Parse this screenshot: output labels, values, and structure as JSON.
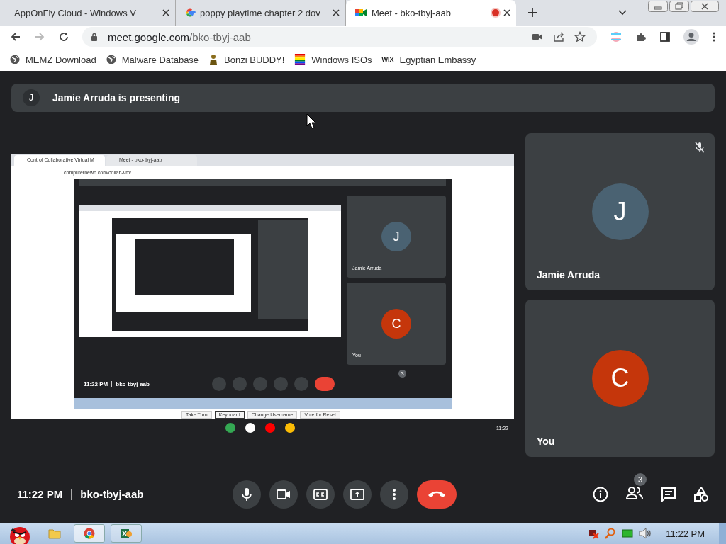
{
  "browser": {
    "tabs": [
      {
        "title": "AppOnFly Cloud - Windows V",
        "selected": false,
        "kind": "plain",
        "recording": false
      },
      {
        "title": "poppy playtime chapter 2 dov",
        "selected": false,
        "kind": "google",
        "recording": false
      },
      {
        "title": "Meet - bko-tbyj-aab",
        "selected": true,
        "kind": "meet",
        "recording": true
      }
    ],
    "url_host": "meet.google.com",
    "url_path": "/bko-tbyj-aab",
    "bookmarks": [
      {
        "label": "MEMZ Download",
        "kind": "globe"
      },
      {
        "label": "Malware Database",
        "kind": "globe"
      },
      {
        "label": "Bonzi BUDDY!",
        "kind": "figure"
      },
      {
        "label": "Windows ISOs",
        "kind": "rainbow"
      },
      {
        "label": "Egyptian Embassy",
        "kind": "wix",
        "logo": "WIX"
      }
    ]
  },
  "presenting": {
    "initial": "J",
    "text": "Jamie Arruda is presenting"
  },
  "shared_screen": {
    "tabs": [
      {
        "title": "Control Collaborative Virtual M",
        "selected": true
      },
      {
        "title": "Meet - bko-tbyj-aab",
        "selected": false
      }
    ],
    "url": "computernewb.com/collab-vm/",
    "tiles": [
      {
        "initial": "J",
        "name": "Jamie Arruda",
        "color": "#4a6272"
      },
      {
        "initial": "C",
        "name": "You",
        "color": "#c5360b"
      }
    ],
    "time": "11:22 PM",
    "meeting_code": "bko-tbyj-aab",
    "participant_count": "3",
    "vm_buttons": [
      {
        "label": "Take Turn",
        "selected": false
      },
      {
        "label": "Keyboard",
        "selected": true
      },
      {
        "label": "Change Username",
        "selected": false
      },
      {
        "label": "Vote for Reset",
        "selected": false
      }
    ],
    "shelf_time": "11:22"
  },
  "tiles": [
    {
      "initial": "J",
      "name": "Jamie Arruda",
      "color": "#4a6272",
      "muted": true
    },
    {
      "initial": "C",
      "name": "You",
      "color": "#c5360b",
      "muted": false
    }
  ],
  "call_bar": {
    "time": "11:22 PM",
    "meeting_code": "bko-tbyj-aab",
    "participant_count": "3"
  },
  "taskbar": {
    "time": "11:22 PM"
  }
}
